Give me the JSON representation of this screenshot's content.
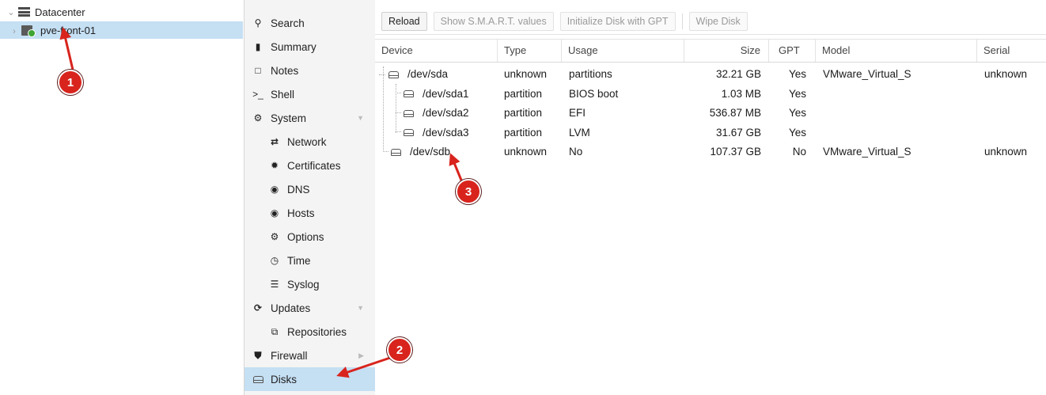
{
  "tree": {
    "datacenter_label": "Datacenter",
    "node_label": "pve-front-01"
  },
  "nav": {
    "items": [
      {
        "label": "Search",
        "icon": "search-icon"
      },
      {
        "label": "Summary",
        "icon": "book-icon"
      },
      {
        "label": "Notes",
        "icon": "note-icon"
      },
      {
        "label": "Shell",
        "icon": "terminal-icon"
      },
      {
        "label": "System",
        "icon": "gears-icon"
      },
      {
        "label": "Network",
        "icon": "exchange-icon"
      },
      {
        "label": "Certificates",
        "icon": "certificate-icon"
      },
      {
        "label": "DNS",
        "icon": "globe-icon"
      },
      {
        "label": "Hosts",
        "icon": "globe-icon"
      },
      {
        "label": "Options",
        "icon": "gear-icon"
      },
      {
        "label": "Time",
        "icon": "clock-icon"
      },
      {
        "label": "Syslog",
        "icon": "list-icon"
      },
      {
        "label": "Updates",
        "icon": "refresh-icon"
      },
      {
        "label": "Repositories",
        "icon": "files-icon"
      },
      {
        "label": "Firewall",
        "icon": "shield-icon"
      },
      {
        "label": "Disks",
        "icon": "hdd-icon"
      }
    ],
    "active": "Disks"
  },
  "toolbar": {
    "reload": "Reload",
    "smart": "Show S.M.A.R.T. values",
    "init_gpt": "Initialize Disk with GPT",
    "wipe": "Wipe Disk"
  },
  "grid": {
    "columns": [
      "Device",
      "Type",
      "Usage",
      "Size",
      "GPT",
      "Model",
      "Serial"
    ],
    "rows": [
      {
        "device": "/dev/sda",
        "type": "unknown",
        "usage": "partitions",
        "size": "32.21 GB",
        "gpt": "Yes",
        "model": "VMware_Virtual_S",
        "serial": "unknown"
      },
      {
        "device": "/dev/sda1",
        "type": "partition",
        "usage": "BIOS boot",
        "size": "1.03 MB",
        "gpt": "Yes",
        "model": "",
        "serial": ""
      },
      {
        "device": "/dev/sda2",
        "type": "partition",
        "usage": "EFI",
        "size": "536.87 MB",
        "gpt": "Yes",
        "model": "",
        "serial": ""
      },
      {
        "device": "/dev/sda3",
        "type": "partition",
        "usage": "LVM",
        "size": "31.67 GB",
        "gpt": "Yes",
        "model": "",
        "serial": ""
      },
      {
        "device": "/dev/sdb",
        "type": "unknown",
        "usage": "No",
        "size": "107.37 GB",
        "gpt": "No",
        "model": "VMware_Virtual_S",
        "serial": "unknown"
      }
    ]
  },
  "annotations": {
    "one": "1",
    "two": "2",
    "three": "3",
    "color": "#d8241d"
  }
}
